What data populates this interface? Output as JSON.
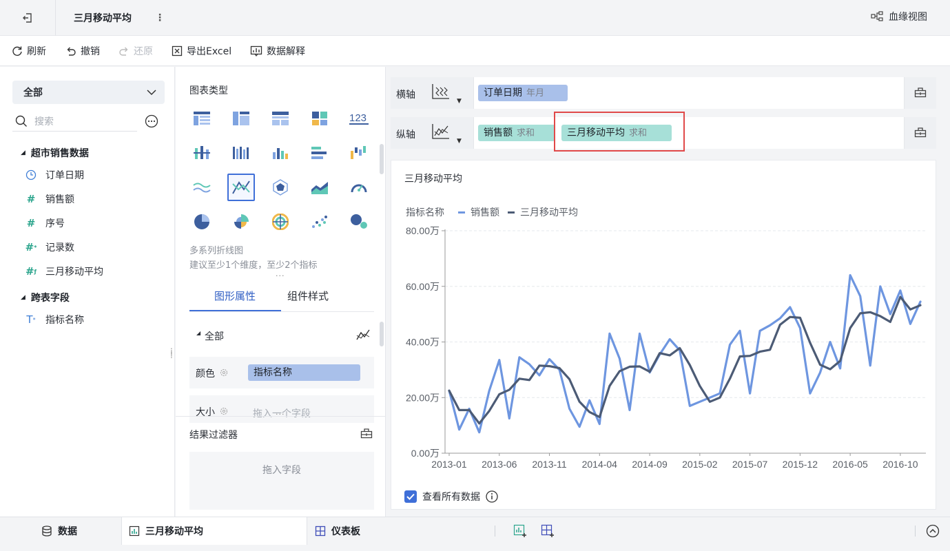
{
  "app": {
    "page_title": "三月移动平均",
    "lineage_label": "血缘视图"
  },
  "toolbar": {
    "refresh": "刷新",
    "undo": "撤销",
    "redo": "还原",
    "export_excel": "导出Excel",
    "data_explain": "数据解释"
  },
  "data_panel": {
    "scope": "全部",
    "search_placeholder": "搜索",
    "groups": [
      {
        "label": "超市销售数据",
        "items": [
          {
            "label": "订单日期",
            "icon": "clock-icon"
          },
          {
            "label": "销售额",
            "icon": "number-icon"
          },
          {
            "label": "序号",
            "icon": "number-icon"
          },
          {
            "label": "记录数",
            "icon": "count-icon"
          },
          {
            "label": "三月移动平均",
            "icon": "calc-number-icon"
          }
        ]
      },
      {
        "label": "跨表字段",
        "items": [
          {
            "label": "指标名称",
            "icon": "text-icon"
          }
        ]
      }
    ]
  },
  "config_panel": {
    "chart_types_title": "图表类型",
    "selected_type_name": "多系列折线图",
    "selected_type_hint": "建议至少1个维度，至少2个指标",
    "tabs": [
      "图形属性",
      "组件样式"
    ],
    "all_label": "全部",
    "color_label": "颜色",
    "color_field": "指标名称",
    "size_label": "大小",
    "size_placeholder": "拖入一个字段",
    "filter_title": "结果过滤器",
    "filter_placeholder": "拖入字段"
  },
  "axes": {
    "x_label": "横轴",
    "y_label": "纵轴",
    "x_fields": [
      {
        "name": "订单日期",
        "agg": "年月"
      }
    ],
    "y_fields": [
      {
        "name": "销售额",
        "agg": "求和"
      },
      {
        "name": "三月移动平均",
        "agg": "求和"
      }
    ]
  },
  "chart_card": {
    "title": "三月移动平均",
    "legend_title": "指标名称",
    "view_all_label": "查看所有数据"
  },
  "colors": {
    "sales": "#6e96e0",
    "moving_avg": "#4c5b75",
    "accent": "#3f6fd8",
    "highlight": "#e04848"
  },
  "chart_data": {
    "type": "line",
    "title": "",
    "xlabel": "",
    "ylabel": "",
    "ylim": [
      0,
      80
    ],
    "y_ticks": [
      "0.00万",
      "20.00万",
      "40.00万",
      "60.00万",
      "80.00万"
    ],
    "x_tick_labels": [
      "2013-01",
      "2013-06",
      "2013-11",
      "2014-04",
      "2014-09",
      "2015-02",
      "2015-07",
      "2015-12",
      "2016-05",
      "2016-10"
    ],
    "x": [
      "2013-01",
      "2013-02",
      "2013-03",
      "2013-04",
      "2013-05",
      "2013-06",
      "2013-07",
      "2013-08",
      "2013-09",
      "2013-10",
      "2013-11",
      "2013-12",
      "2014-01",
      "2014-02",
      "2014-03",
      "2014-04",
      "2014-05",
      "2014-06",
      "2014-07",
      "2014-08",
      "2014-09",
      "2014-10",
      "2014-11",
      "2014-12",
      "2015-01",
      "2015-02",
      "2015-03",
      "2015-04",
      "2015-05",
      "2015-06",
      "2015-07",
      "2015-08",
      "2015-09",
      "2015-10",
      "2015-11",
      "2015-12",
      "2016-01",
      "2016-02",
      "2016-03",
      "2016-04",
      "2016-05",
      "2016-06",
      "2016-07",
      "2016-08",
      "2016-09",
      "2016-10",
      "2016-11",
      "2016-12"
    ],
    "series": [
      {
        "name": "销售额",
        "values": [
          22.5,
          8.5,
          16.0,
          7.5,
          22.5,
          33.5,
          12.5,
          34.5,
          32.0,
          28.0,
          33.8,
          30.0,
          16.0,
          9.5,
          19.0,
          10.5,
          43.0,
          34.0,
          15.5,
          43.0,
          29.0,
          35.5,
          41.0,
          37.0,
          17.0,
          18.5,
          20.0,
          21.5,
          39.0,
          44.0,
          21.5,
          44.0,
          46.0,
          48.5,
          52.5,
          45.0,
          21.5,
          29.0,
          40.0,
          30.5,
          64.0,
          56.5,
          31.5,
          60.0,
          50.0,
          58.5,
          46.5,
          54.5
        ]
      },
      {
        "name": "三月移动平均",
        "values": [
          22.5,
          15.5,
          15.5,
          10.7,
          15.2,
          21.2,
          22.8,
          26.8,
          26.3,
          31.5,
          31.3,
          30.6,
          26.6,
          18.5,
          14.8,
          13.0,
          24.2,
          29.5,
          31.1,
          31.2,
          29.3,
          36.0,
          35.2,
          37.8,
          31.7,
          24.2,
          18.5,
          20.0,
          26.8,
          34.8,
          35.0,
          36.5,
          37.2,
          46.2,
          49.0,
          48.7,
          39.7,
          31.8,
          30.2,
          33.2,
          45.0,
          50.3,
          50.7,
          49.3,
          47.2,
          56.2,
          51.7,
          53.2
        ]
      }
    ]
  }
}
